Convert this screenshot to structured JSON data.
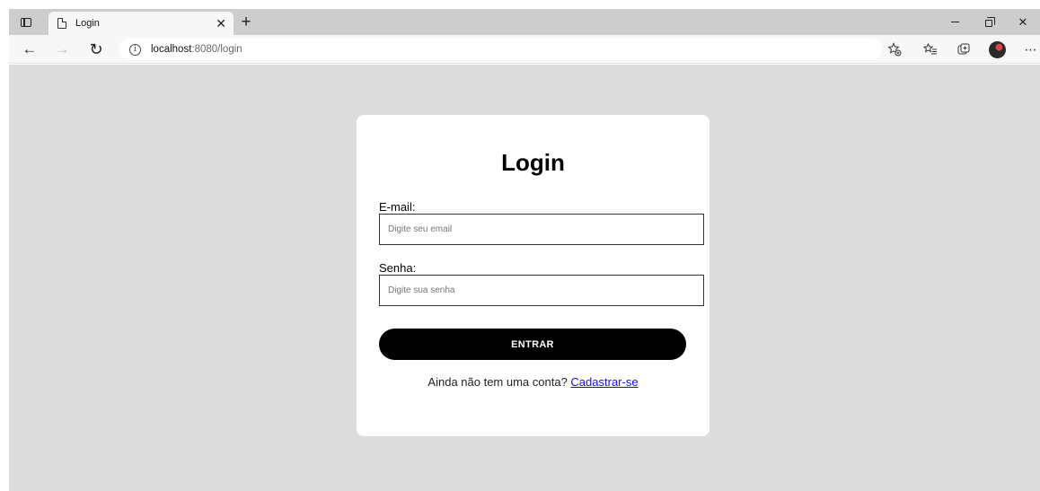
{
  "browser": {
    "tab": {
      "title": "Login"
    },
    "address": {
      "host": "localhost",
      "path": ":8080/login"
    }
  },
  "page": {
    "title": "Login",
    "email": {
      "label": "E-mail:",
      "placeholder": "Digite seu email",
      "value": ""
    },
    "password": {
      "label": "Senha:",
      "placeholder": "Digite sua senha",
      "value": ""
    },
    "submit_label": "ENTRAR",
    "signup_prompt": "Ainda não tem uma conta? ",
    "signup_link": "Cadastrar-se"
  },
  "colors": {
    "page_background": "#dcdcdc",
    "card_background": "#ffffff",
    "button_background": "#000000",
    "link": "#1a0dcc"
  }
}
